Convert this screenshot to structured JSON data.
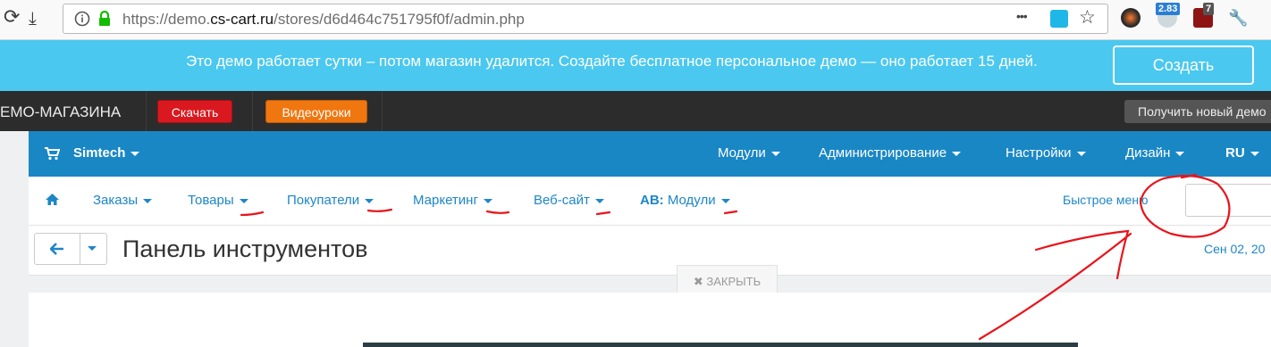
{
  "browser": {
    "url_prefix": "https://demo.",
    "url_domain": "cs-cart.ru",
    "url_path": "/stores/d6d464c751795f0f/admin.php",
    "reload_glyph": "⟳",
    "download_glyph": "⤓",
    "more_glyph": "•••",
    "star_glyph": "☆",
    "wrench_glyph": "🔧",
    "ext_badge_1": "2.83",
    "ext_badge_2": "7",
    "icons": [
      "reload-icon",
      "download-icon",
      "info-icon",
      "lock-icon",
      "more-icon",
      "bookmark-star-icon",
      "wrench-icon"
    ]
  },
  "notice": {
    "text": "Это демо работает сутки – потом магазин удалится. Создайте бесплатное персональное демо — оно работает 15 дней.",
    "create_label": "Создать"
  },
  "demo_toolbar": {
    "title": "ЕМО-МАГАЗИНА",
    "download_label": "Скачать",
    "video_label": "Видеоуроки",
    "new_demo_label": "Получить новый демо"
  },
  "admin_header": {
    "store_name": "Simtech",
    "menu": [
      "Модули",
      "Администрирование",
      "Настройки",
      "Дизайн",
      "RU"
    ]
  },
  "nav": {
    "items": [
      "Заказы",
      "Товары",
      "Покупатели",
      "Маркетинг",
      "Веб-сайт"
    ],
    "ab_prefix": "AB:",
    "ab_label": "Модули",
    "quick_menu_label": "Быстрое меню"
  },
  "page": {
    "title": "Панель инструментов",
    "date": "Сен 02, 20",
    "close_label": "ЗАКРЫТЬ",
    "close_glyph": "✖"
  },
  "colors": {
    "notice_bg": "#4ac8ef",
    "header_bg": "#1a87c5",
    "link": "#1d86c7",
    "download_btn": "#d9191f",
    "video_btn": "#f0760f",
    "annotation": "#e8141b"
  }
}
